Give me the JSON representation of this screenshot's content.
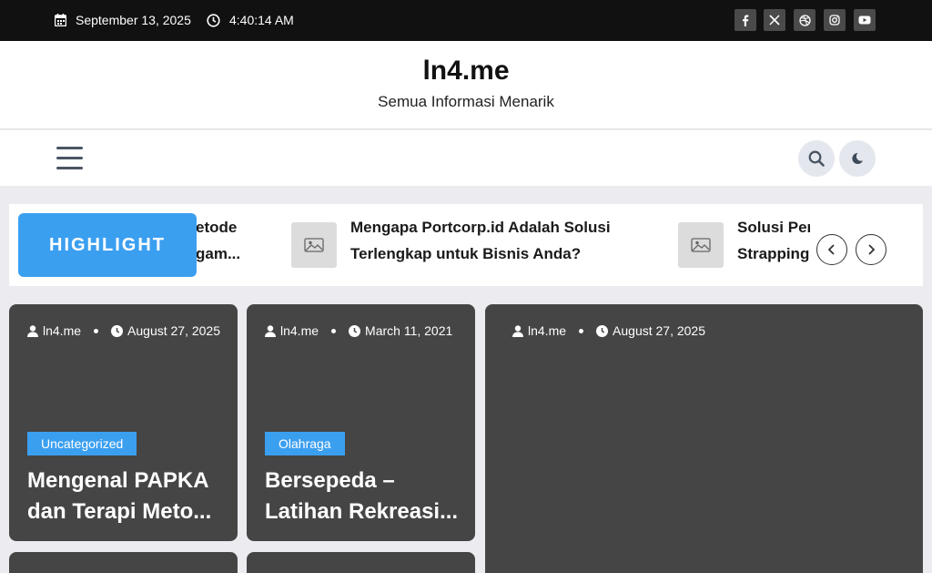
{
  "topbar": {
    "date": "September 13, 2025",
    "time": "4:40:14 AM",
    "social": [
      "facebook-icon",
      "x-icon",
      "dribbble-icon",
      "instagram-icon",
      "youtube-icon"
    ]
  },
  "brand": {
    "title": "ln4.me",
    "tagline": "Semua Informasi Menarik"
  },
  "highlight": {
    "label": "HIGHLIGHT",
    "items": [
      {
        "line1": "etode",
        "line2": "gam..."
      },
      {
        "line1": "Mengapa Portcorp.id Adalah Solusi",
        "line2": "Terlengkap untuk Bisnis Anda?"
      },
      {
        "line1": "Solusi Per",
        "line2": "Strapping"
      }
    ]
  },
  "cards": [
    {
      "author": "ln4.me",
      "date": "August 27, 2025",
      "category": "Uncategorized",
      "title_line1": "Mengenal PAPKA",
      "title_line2": "dan Terapi Meto..."
    },
    {
      "author": "ln4.me",
      "date": "March 11, 2021",
      "category": "Olahraga",
      "title_line1": "Bersepeda –",
      "title_line2": "Latihan Rekreasi..."
    },
    {
      "author": "ln4.me",
      "date": "August 27, 2025"
    }
  ],
  "colors": {
    "accent": "#3b9ff0",
    "topbar_bg": "#111111",
    "card_bg": "#454545",
    "page_bg": "#ececf0"
  }
}
